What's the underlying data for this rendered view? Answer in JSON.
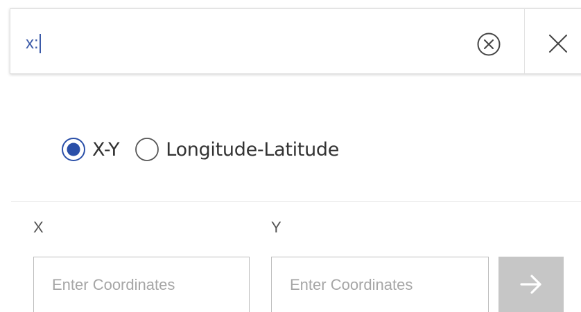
{
  "search": {
    "value": "x:",
    "clear_icon": "circle-x-icon",
    "close_icon": "close-icon"
  },
  "coordinate_mode": {
    "options": [
      {
        "label": "X-Y",
        "selected": true
      },
      {
        "label": "Longitude-Latitude",
        "selected": false
      }
    ]
  },
  "fields": {
    "x": {
      "label": "X",
      "placeholder": "Enter Coordinates",
      "value": ""
    },
    "y": {
      "label": "Y",
      "placeholder": "Enter Coordinates",
      "value": ""
    }
  },
  "go_button": {
    "icon": "arrow-right-icon",
    "enabled": false
  },
  "colors": {
    "accent": "#3b5aa8",
    "radio_selected": "#2a4fa8",
    "button_disabled": "#c6c6c6",
    "border": "#bdbdbd",
    "placeholder": "#a6a6a6"
  }
}
